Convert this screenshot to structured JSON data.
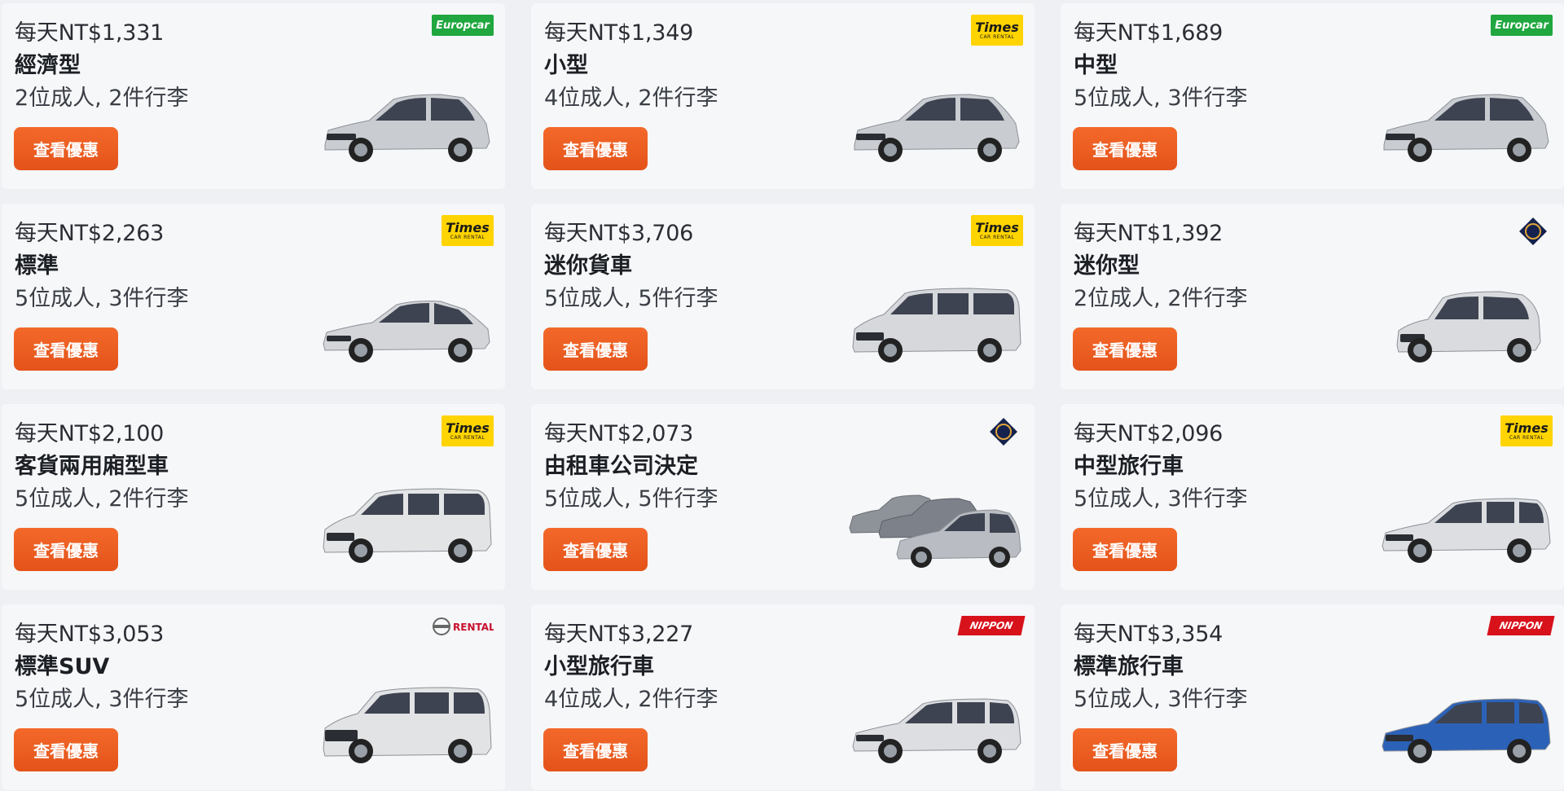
{
  "button_label": "查看優惠",
  "cards": [
    {
      "price": "每天NT$1,331",
      "type": "經濟型",
      "capacity": "2位成人, 2件行李",
      "vendor": "Europcar",
      "logo": "europcar-logo",
      "car_color": "#c9ccd1",
      "shape": "hatch"
    },
    {
      "price": "每天NT$1,349",
      "type": "小型",
      "capacity": "4位成人, 2件行李",
      "vendor": "Times",
      "vendor_sub": "CAR RENTAL",
      "logo": "times-logo",
      "car_color": "#c9ccd1",
      "shape": "hatch"
    },
    {
      "price": "每天NT$1,689",
      "type": "中型",
      "capacity": "5位成人, 3件行李",
      "vendor": "Europcar",
      "logo": "europcar-logo",
      "car_color": "#c9ccd1",
      "shape": "hatch"
    },
    {
      "price": "每天NT$2,263",
      "type": "標準",
      "capacity": "5位成人, 3件行李",
      "vendor": "Times",
      "vendor_sub": "CAR RENTAL",
      "logo": "times-logo",
      "car_color": "#d3d5d9",
      "shape": "sedan"
    },
    {
      "price": "每天NT$3,706",
      "type": "迷你貨車",
      "capacity": "5位成人, 5件行李",
      "vendor": "Times",
      "vendor_sub": "CAR RENTAL",
      "logo": "times-logo",
      "car_color": "#d6d8dc",
      "shape": "van"
    },
    {
      "price": "每天NT$1,392",
      "type": "迷你型",
      "capacity": "2位成人, 2件行李",
      "vendor": "ORIX",
      "logo": "orix-logo",
      "car_color": "#d9dbde",
      "shape": "mini"
    },
    {
      "price": "每天NT$2,100",
      "type": "客貨兩用廂型車",
      "capacity": "5位成人, 2件行李",
      "vendor": "Times",
      "vendor_sub": "CAR RENTAL",
      "logo": "times-logo",
      "car_color": "#e3e4e6",
      "shape": "van"
    },
    {
      "price": "每天NT$2,073",
      "type": "由租車公司決定",
      "capacity": "5位成人, 5件行李",
      "vendor": "ORIX",
      "logo": "orix-logo",
      "car_color": "#b9bcc2",
      "shape": "group"
    },
    {
      "price": "每天NT$2,096",
      "type": "中型旅行車",
      "capacity": "5位成人, 3件行李",
      "vendor": "Times",
      "vendor_sub": "CAR RENTAL",
      "logo": "times-logo",
      "car_color": "#dcdee1",
      "shape": "wagon"
    },
    {
      "price": "每天NT$3,053",
      "type": "標準SUV",
      "capacity": "5位成人, 3件行李",
      "vendor": "RENTAL",
      "logo": "nissan-rental-logo",
      "car_color": "#e2e3e5",
      "shape": "suv"
    },
    {
      "price": "每天NT$3,227",
      "type": "小型旅行車",
      "capacity": "4位成人, 2件行李",
      "vendor": "NIPPON",
      "logo": "nippon-rent-a-car-logo",
      "car_color": "#dcdee1",
      "shape": "wagon"
    },
    {
      "price": "每天NT$3,354",
      "type": "標準旅行車",
      "capacity": "5位成人, 3件行李",
      "vendor": "NIPPON",
      "logo": "nippon-rent-a-car-logo",
      "car_color": "#2b62b8",
      "shape": "wagon"
    }
  ]
}
